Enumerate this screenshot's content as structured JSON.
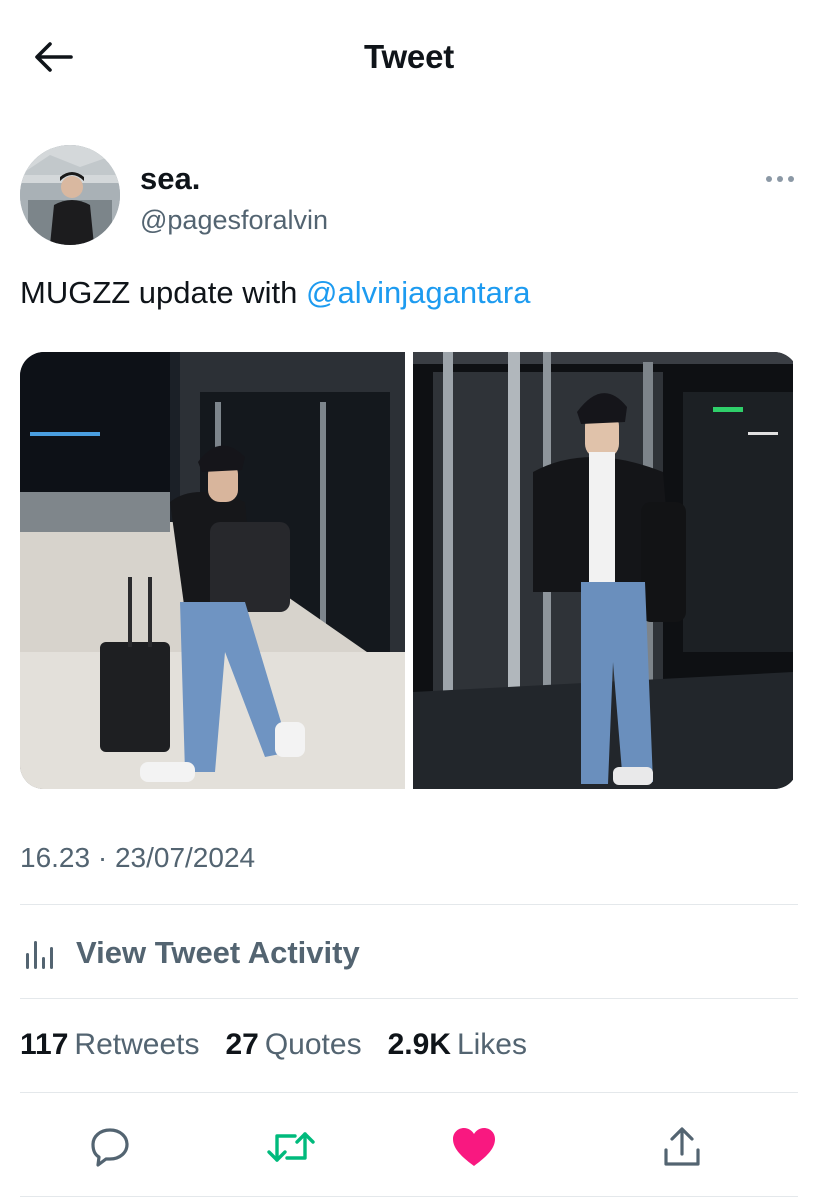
{
  "header": {
    "title": "Tweet"
  },
  "author": {
    "display_name": "sea.",
    "handle": "@pagesforalvin"
  },
  "tweet": {
    "text": "MUGZZ update with ",
    "mention": "@alvinjagantara"
  },
  "meta": {
    "timestamp": "16.23 · 23/07/2024"
  },
  "activity": {
    "label": "View Tweet Activity"
  },
  "stats": [
    {
      "count": "117",
      "label": "Retweets"
    },
    {
      "count": "27",
      "label": "Quotes"
    },
    {
      "count": "2.9K",
      "label": "Likes"
    }
  ],
  "colors": {
    "accent": "#1d9bf0",
    "retweet": "#00ba7c",
    "like": "#f91880",
    "secondary": "#536471"
  },
  "icons": [
    "back-arrow-icon",
    "more-icon",
    "activity-icon",
    "reply-icon",
    "retweet-icon",
    "like-icon",
    "share-icon"
  ]
}
